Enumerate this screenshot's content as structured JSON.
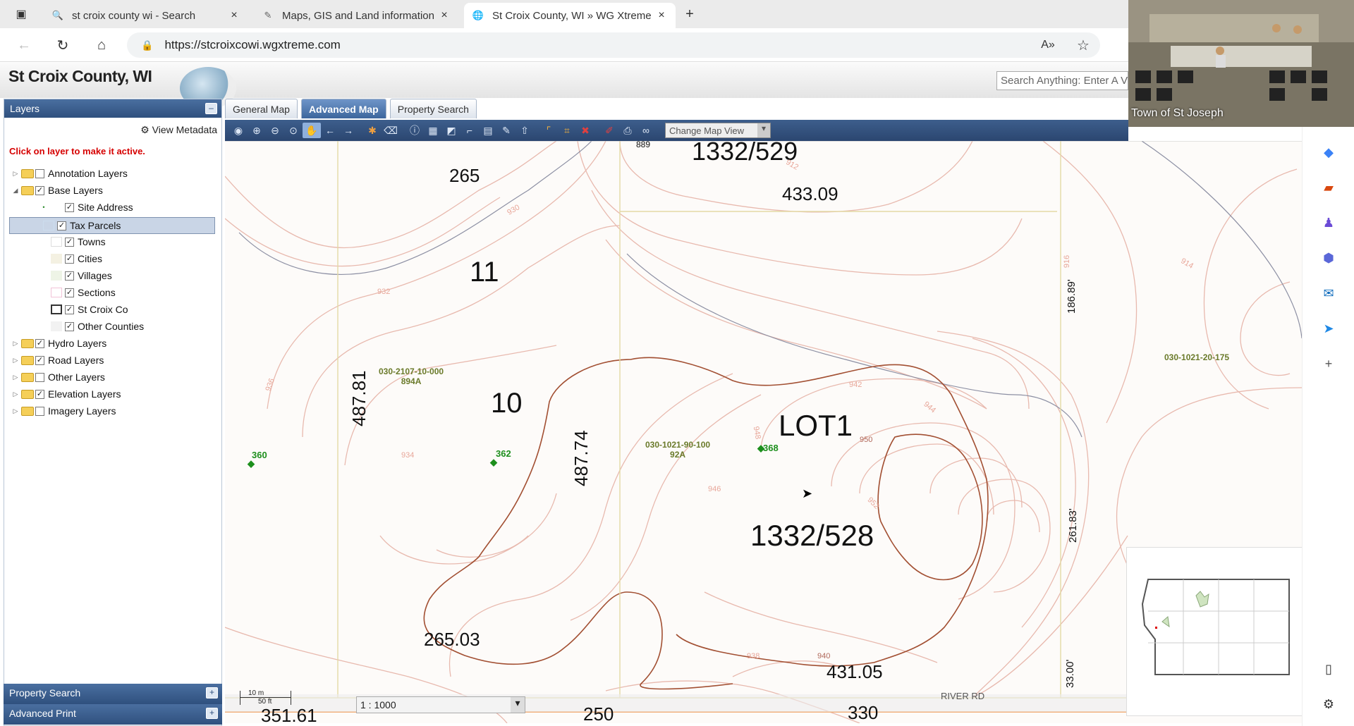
{
  "browser": {
    "tabs": [
      {
        "title": "st croix county wi - Search",
        "icon": "search-icon"
      },
      {
        "title": "Maps, GIS and Land information",
        "icon": "map-icon"
      },
      {
        "title": "St Croix County, WI » WG Xtreme",
        "icon": "globe-icon"
      }
    ],
    "url": "https://stcroixcowi.wgxtreme.com"
  },
  "app": {
    "title": "St Croix County, WI",
    "search_placeholder": "Search Anything: Enter A V"
  },
  "layers_panel": {
    "title": "Layers",
    "view_metadata": "View Metadata",
    "note": "Click on layer to make it active.",
    "items": [
      {
        "label": "Annotation Layers",
        "checked": false
      },
      {
        "label": "Base Layers",
        "checked": true
      },
      {
        "label": "Site Address",
        "checked": true
      },
      {
        "label": "Tax Parcels",
        "checked": true
      },
      {
        "label": "Towns",
        "checked": true
      },
      {
        "label": "Cities",
        "checked": true
      },
      {
        "label": "Villages",
        "checked": true
      },
      {
        "label": "Sections",
        "checked": true
      },
      {
        "label": "St Croix Co",
        "checked": true
      },
      {
        "label": "Other Counties",
        "checked": true
      },
      {
        "label": "Hydro Layers",
        "checked": true
      },
      {
        "label": "Road Layers",
        "checked": true
      },
      {
        "label": "Other Layers",
        "checked": false
      },
      {
        "label": "Elevation Layers",
        "checked": true
      },
      {
        "label": "Imagery Layers",
        "checked": false
      }
    ],
    "property_search": "Property Search",
    "advanced_print": "Advanced Print"
  },
  "map_tabs": [
    "General Map",
    "Advanced Map",
    "Property Search"
  ],
  "toolbar": {
    "change_view": "Change Map View"
  },
  "map": {
    "labels": {
      "l1332_529": "1332/529",
      "l433": "433.09",
      "l265": "265",
      "l11": "11",
      "l10": "10",
      "lot1": "LOT1",
      "l1332_528": "1332/528",
      "l265_03": "265.03",
      "l431": "431.05",
      "l487_81": "487.81",
      "l487_74": "487.74",
      "l186": "186.89'",
      "l261": "261.83'",
      "l33": "33.00'",
      "l351": "351.61",
      "l250": "250",
      "l330": "330",
      "l889": "889",
      "river_rd": "RIVER RD"
    },
    "pins": {
      "p360": "360",
      "p362": "362",
      "p368": "368"
    },
    "parcels": {
      "a_id": "030-2107-10-000",
      "a_area": "894A",
      "b_id": "030-1021-90-100",
      "b_area": "92A",
      "c_id": "030-1021-20-175"
    },
    "contours": [
      "930",
      "932",
      "934",
      "936",
      "938",
      "940",
      "942",
      "944",
      "946",
      "948",
      "950",
      "952",
      "912",
      "914",
      "916"
    ],
    "scale": "1 : 1000",
    "scalebar": {
      "m": "10 m",
      "ft": "50 ft"
    }
  },
  "webcam": {
    "caption": "Town of St Joseph"
  }
}
